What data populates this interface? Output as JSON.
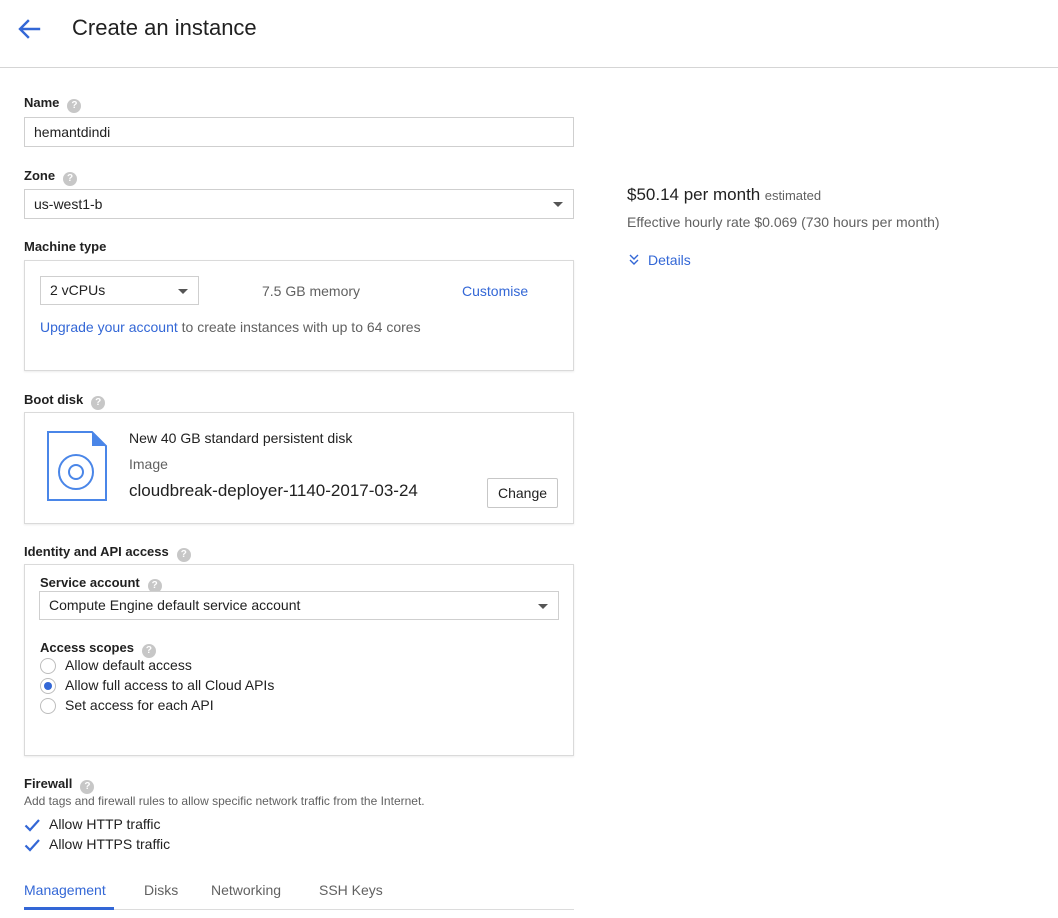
{
  "header": {
    "title": "Create an instance"
  },
  "name": {
    "label": "Name",
    "value": "hemantdindi"
  },
  "zone": {
    "label": "Zone",
    "value": "us-west1-b"
  },
  "machine_type": {
    "label": "Machine type",
    "cpu_value": "2 vCPUs",
    "memory": "7.5 GB memory",
    "customise": "Customise",
    "upgrade_link": "Upgrade your account",
    "upgrade_text": " to create instances with up to 64 cores"
  },
  "boot_disk": {
    "label": "Boot disk",
    "disk_desc": "New 40 GB standard persistent disk",
    "image_label": "Image",
    "image_name": "cloudbreak-deployer-1140-2017-03-24",
    "change": "Change"
  },
  "identity": {
    "label": "Identity and API access",
    "service_account_label": "Service account",
    "service_account_value": "Compute Engine default service account",
    "access_scopes_label": "Access scopes",
    "scopes": [
      {
        "label": "Allow default access",
        "selected": false
      },
      {
        "label": "Allow full access to all Cloud APIs",
        "selected": true
      },
      {
        "label": "Set access for each API",
        "selected": false
      }
    ]
  },
  "firewall": {
    "label": "Firewall",
    "description": "Add tags and firewall rules to allow specific network traffic from the Internet.",
    "options": [
      {
        "label": "Allow HTTP traffic",
        "checked": true
      },
      {
        "label": "Allow HTTPS traffic",
        "checked": true
      }
    ]
  },
  "tabs": [
    {
      "label": "Management",
      "active": true
    },
    {
      "label": "Disks",
      "active": false
    },
    {
      "label": "Networking",
      "active": false
    },
    {
      "label": "SSH Keys",
      "active": false
    }
  ],
  "pricing": {
    "price": "$50.14 per month",
    "estimated": "estimated",
    "hourly": "Effective hourly rate $0.069 (730 hours per month)",
    "details": "Details"
  },
  "colors": {
    "accent": "#3367d6",
    "text": "#212121",
    "muted": "#616161",
    "border": "#cfcfcf"
  },
  "icons": [
    "arrow-back-icon",
    "help-icon",
    "dropdown-caret-icon",
    "disk-image-icon",
    "chevron-double-down-icon",
    "checkmark-icon"
  ]
}
